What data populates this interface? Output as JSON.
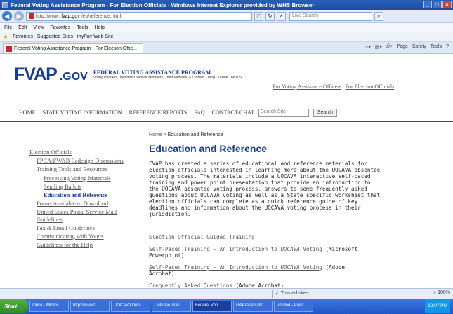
{
  "browser": {
    "window_title": "Federal Voting Assistance Program - For Election Officials - Windows Internet Explorer provided by WHS Browser",
    "url_prefix": "http://www.",
    "url_domain": "fvap.gov",
    "url_path": "/eo/reference.html",
    "live_search_placeholder": "Live Search",
    "menu": [
      "File",
      "Edit",
      "View",
      "Favorites",
      "Tools",
      "Help"
    ],
    "favorites_label": "Favorites",
    "favorites_items": [
      "Suggested Sites",
      "myPay Web Site"
    ],
    "tab_title": "Federal Voting Assistance Program - For Election Offic...",
    "command_bar": [
      "Page",
      "Safety",
      "Tools"
    ],
    "status_zone": "Trusted sites",
    "zoom": "100%"
  },
  "site": {
    "logo_text": "FVAP",
    "logo_gov": ".GOV",
    "program_name": "FEDERAL VOTING ASSISTANCE PROGRAM",
    "program_tagline": "Voting Help For Uniformed Service Members, Their Families, & Citizens Living Outside The U.S.",
    "toplink_1": "For Voting Assistance Officers",
    "toplink_sep": "|",
    "toplink_2": "For Election Officials",
    "nav": [
      "HOME",
      "STATE VOTING INFORMATION",
      "REFERENCE/REPORTS",
      "FAQ",
      "CONTACT/CHAT"
    ],
    "search_placeholder": "Search Site",
    "search_button": "Search"
  },
  "sidebar": {
    "items": [
      {
        "label": "Election Officials",
        "level": 1
      },
      {
        "label": "FPCA/FWAB Redesign Discussions",
        "level": 2
      },
      {
        "label": "Training Tools and Resources",
        "level": 2
      },
      {
        "label": "Processing Voting Materials",
        "level": 3
      },
      {
        "label": "Sending Ballots",
        "level": 3
      },
      {
        "label": "Education and Reference",
        "level": 3,
        "active": true
      },
      {
        "label": "Forms Available to Download",
        "level": 2
      },
      {
        "label": "United States Postal Service Mail Guidelines",
        "level": 2
      },
      {
        "label": "Fax & Email Guidelines",
        "level": 2
      },
      {
        "label": "Communicating with Voters",
        "level": 2
      },
      {
        "label": "Guidelines for the Help",
        "level": 2
      }
    ]
  },
  "main": {
    "breadcrumb_home": "Home",
    "breadcrumb_current": "> Education and Reference",
    "title": "Education and Reference",
    "intro": "FVAP has created a series of educational and reference materials for election officials interested in learning more about the UOCAVA absentee voting process. The materials include a UOCAVA interactive self-paced training and power point presentation that provide an introduction to the UOCAVA absentee voting process, answers to some frequently asked questions about UOCAVA voting as well as a State specific worksheet that election officials can complete as a quick reference guide of key deadlines and information about the UOCAVA voting process in their jurisdiction.",
    "links": [
      {
        "prefix": "Election Official Guided Training",
        "italic": "",
        "suffix": "",
        "note": ""
      },
      {
        "prefix": "Self-Paced Training – An Introduction to ",
        "italic": "UOCAVA",
        "suffix": " Voting",
        "note": " (Microsoft Powerpoint)"
      },
      {
        "prefix": "Self-Paced Training – An Introduction to ",
        "italic": "UOCAVA",
        "suffix": " Voting",
        "note": " (Adobe Acrobat)"
      },
      {
        "prefix": "Frequently Asked Questions",
        "italic": "",
        "suffix": "",
        "note": " (Adobe Acrobat)"
      }
    ]
  },
  "taskbar": {
    "start": "Start",
    "tasks": [
      "Inbox - Micros...",
      "http://www.f...",
      "UOCAVA Dem...",
      "Defense Trav...",
      "Federal Voti...",
      "GAPresentatio...",
      "untitled - Paint"
    ],
    "clock": "12:07 PM"
  }
}
